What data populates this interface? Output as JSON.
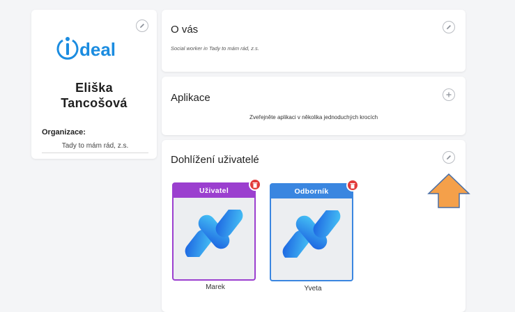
{
  "profile": {
    "logo_text": "deal",
    "first_name": "Eliška",
    "last_name": "Tancošová",
    "org_label": "Organizace:",
    "org_value": "Tady to mám rád, z.s."
  },
  "about": {
    "title": "O vás",
    "text": "Social worker in Tady to mám rád, z.s."
  },
  "apps": {
    "title": "Aplikace",
    "text": "Zveřejněte aplikaci v několika jednoduchých krocích"
  },
  "supervised": {
    "title": "Dohlížení uživatelé",
    "users": [
      {
        "role": "Uživatel",
        "name": "Marek",
        "color": "#9b3fcf"
      },
      {
        "role": "Odborník",
        "name": "Yveta",
        "color": "#3a86e0"
      }
    ]
  },
  "colors": {
    "brand": "#1b8ce0",
    "delete": "#e23b3b",
    "arrow": "#f4a04a"
  },
  "icons": [
    "edit-icon",
    "plus-icon",
    "trash-icon",
    "app-logo-icon",
    "arrow-up-icon"
  ]
}
